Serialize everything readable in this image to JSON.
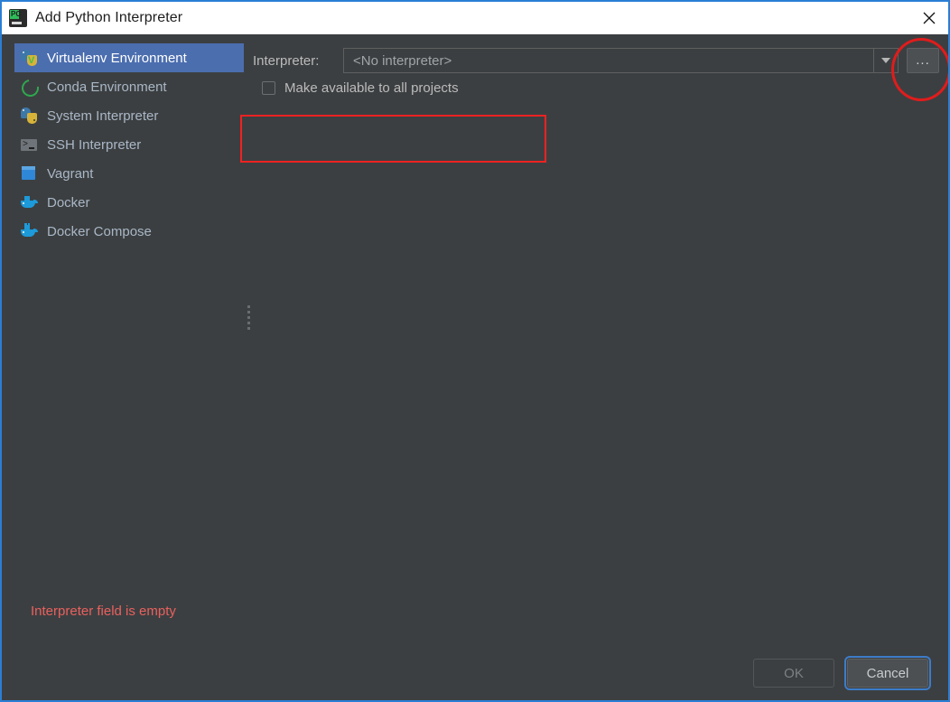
{
  "window": {
    "title": "Add Python Interpreter",
    "app_icon": "pycharm-logo-icon",
    "close_icon": "close-icon",
    "accent_border_color": "#2a7fd4",
    "background_color": "#3c3f41"
  },
  "sidebar": {
    "items": [
      {
        "label": "Virtualenv Environment",
        "icon": "python-virtualenv-icon",
        "selected": true
      },
      {
        "label": "Conda Environment",
        "icon": "conda-ring-icon",
        "selected": false
      },
      {
        "label": "System Interpreter",
        "icon": "python-icon",
        "selected": false
      },
      {
        "label": "SSH Interpreter",
        "icon": "ssh-terminal-icon",
        "selected": false
      },
      {
        "label": "Vagrant",
        "icon": "vagrant-cube-icon",
        "selected": false
      },
      {
        "label": "Docker",
        "icon": "docker-whale-icon",
        "selected": false
      },
      {
        "label": "Docker Compose",
        "icon": "docker-compose-icon",
        "selected": false
      }
    ],
    "selection_color": "#4b6eaf"
  },
  "main": {
    "interpreter": {
      "label": "Interpreter:",
      "value": "<No interpreter>",
      "dropdown_icon": "chevron-down-icon",
      "browse_label": "...",
      "browse_icon": "ellipsis-icon"
    },
    "make_available": {
      "label": "Make available to all projects",
      "checked": false
    },
    "splitter_icon": "splitter-handle-icon"
  },
  "annotations": {
    "rect_color": "#ee2222",
    "ellipse_color": "#e01c1c"
  },
  "status": {
    "error_message": "Interpreter field is empty",
    "error_color": "#e9615e"
  },
  "footer": {
    "ok_label": "OK",
    "ok_enabled": false,
    "cancel_label": "Cancel",
    "cancel_focused": true
  }
}
